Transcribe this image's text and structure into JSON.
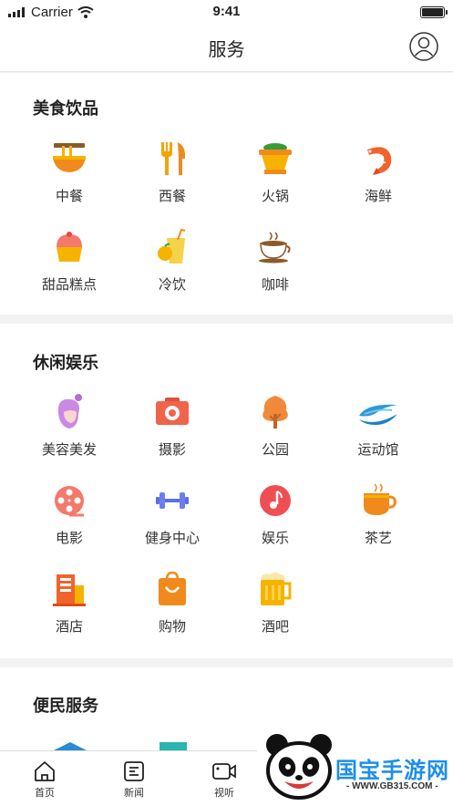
{
  "status_bar": {
    "carrier": "Carrier",
    "time": "9:41"
  },
  "header": {
    "title": "服务"
  },
  "sections": [
    {
      "title": "美食饮品",
      "items": [
        {
          "label": "中餐",
          "icon": "noodle-bowl-icon"
        },
        {
          "label": "西餐",
          "icon": "fork-knife-icon"
        },
        {
          "label": "火锅",
          "icon": "hotpot-icon"
        },
        {
          "label": "海鲜",
          "icon": "shrimp-icon"
        },
        {
          "label": "甜品糕点",
          "icon": "cupcake-icon"
        },
        {
          "label": "冷饮",
          "icon": "cold-drink-icon"
        },
        {
          "label": "咖啡",
          "icon": "coffee-cup-icon"
        }
      ]
    },
    {
      "title": "休闲娱乐",
      "items": [
        {
          "label": "美容美发",
          "icon": "beauty-woman-icon"
        },
        {
          "label": "摄影",
          "icon": "camera-icon"
        },
        {
          "label": "公园",
          "icon": "tree-icon"
        },
        {
          "label": "运动馆",
          "icon": "stadium-icon"
        },
        {
          "label": "电影",
          "icon": "film-reel-icon"
        },
        {
          "label": "健身中心",
          "icon": "dumbbell-icon"
        },
        {
          "label": "娱乐",
          "icon": "music-note-icon"
        },
        {
          "label": "茶艺",
          "icon": "teacup-icon"
        },
        {
          "label": "酒店",
          "icon": "hotel-building-icon"
        },
        {
          "label": "购物",
          "icon": "shopping-bag-icon"
        },
        {
          "label": "酒吧",
          "icon": "beer-mug-icon"
        }
      ]
    },
    {
      "title": "便民服务",
      "items": []
    }
  ],
  "tabbar": [
    {
      "label": "首页",
      "icon": "home-icon"
    },
    {
      "label": "新闻",
      "icon": "news-icon"
    },
    {
      "label": "视听",
      "icon": "video-camera-icon"
    }
  ],
  "watermark": {
    "title": "国宝手游网",
    "url": "- WWW.GB315.COM -"
  }
}
